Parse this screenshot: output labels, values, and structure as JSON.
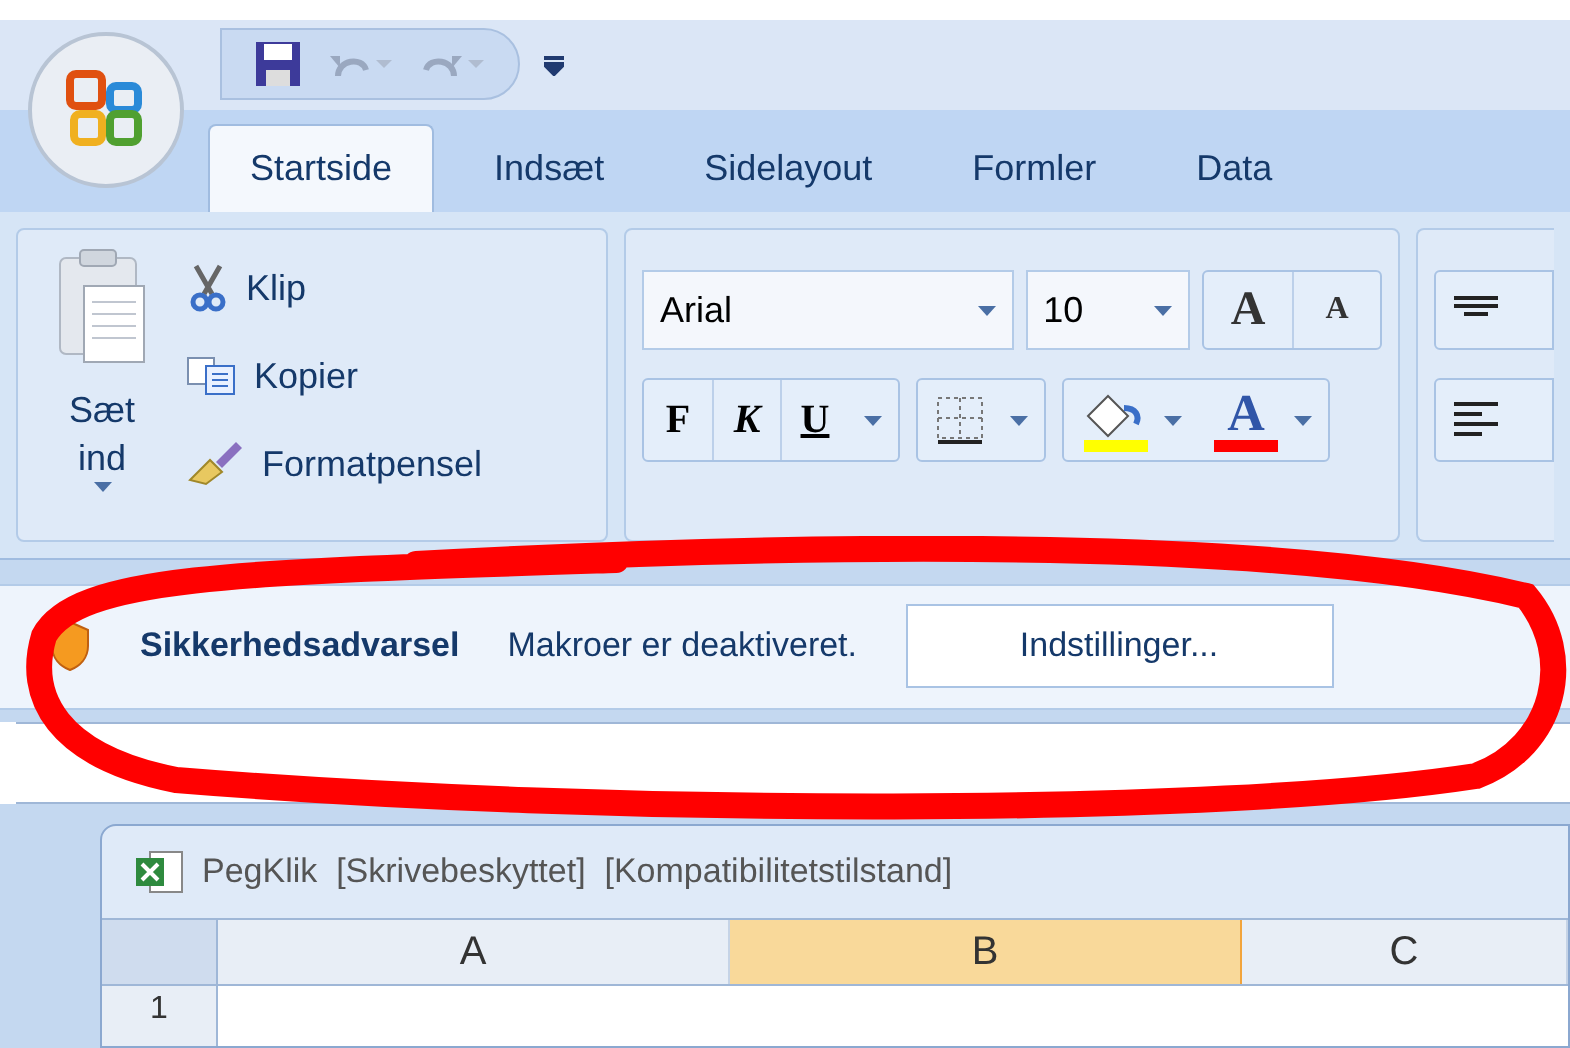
{
  "tabs": [
    {
      "label": "Startside",
      "selected": true
    },
    {
      "label": "Indsæt",
      "selected": false
    },
    {
      "label": "Sidelayout",
      "selected": false
    },
    {
      "label": "Formler",
      "selected": false
    },
    {
      "label": "Data",
      "selected": false
    }
  ],
  "clipboard": {
    "paste": "Sæt ind",
    "items": [
      {
        "kind": "cut",
        "label": "Klip"
      },
      {
        "kind": "copy",
        "label": "Kopier"
      },
      {
        "kind": "brush",
        "label": "Formatpensel"
      }
    ]
  },
  "font": {
    "name": "Arial",
    "size": "10",
    "grow": "A",
    "shrink": "A",
    "bold": "F",
    "italic": "K",
    "underline": "U",
    "color_letter": "A"
  },
  "message_bar": {
    "title": "Sikkerhedsadvarsel",
    "message": "Makroer er deaktiveret.",
    "button": "Indstillinger..."
  },
  "workbook": {
    "title": "PegKlik  [Skrivebeskyttet]  [Kompatibilitetstilstand]",
    "columns": [
      {
        "label": "A",
        "selected": false
      },
      {
        "label": "B",
        "selected": true
      },
      {
        "label": "C",
        "selected": false
      }
    ],
    "rows": [
      "1"
    ]
  }
}
